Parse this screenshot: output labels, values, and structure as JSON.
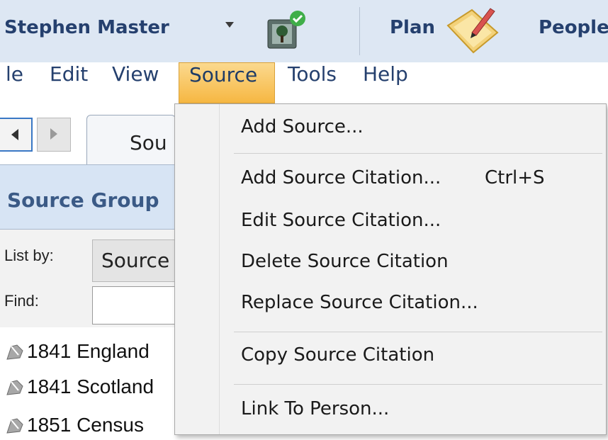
{
  "header": {
    "user_name": "Stephen Master",
    "nav_plan": "Plan",
    "nav_people": "People"
  },
  "menubar": {
    "file": "le",
    "edit": "Edit",
    "view": "View",
    "source": "Source",
    "tools": "Tools",
    "help": "Help"
  },
  "left_pane": {
    "tab_label": "Sou",
    "group_title": "Source Group",
    "list_by_label": "List by:",
    "list_by_value": "Source",
    "find_label": "Find:",
    "find_value": "",
    "items": [
      "1841 England",
      "1841 Scotland",
      "1851 Census"
    ]
  },
  "source_menu": {
    "add_source": "Add Source...",
    "add_citation": "Add Source Citation...",
    "add_citation_shortcut": "Ctrl+S",
    "edit_citation": "Edit Source Citation...",
    "delete_citation": "Delete Source Citation",
    "replace_citation": "Replace Source Citation...",
    "copy_citation": "Copy Source Citation",
    "link_to_person": "Link To Person..."
  },
  "colors": {
    "header_bg": "#dde7f3",
    "header_text": "#25406e",
    "menu_active": "#f6b742",
    "menu_bg": "#f2f2f2"
  }
}
